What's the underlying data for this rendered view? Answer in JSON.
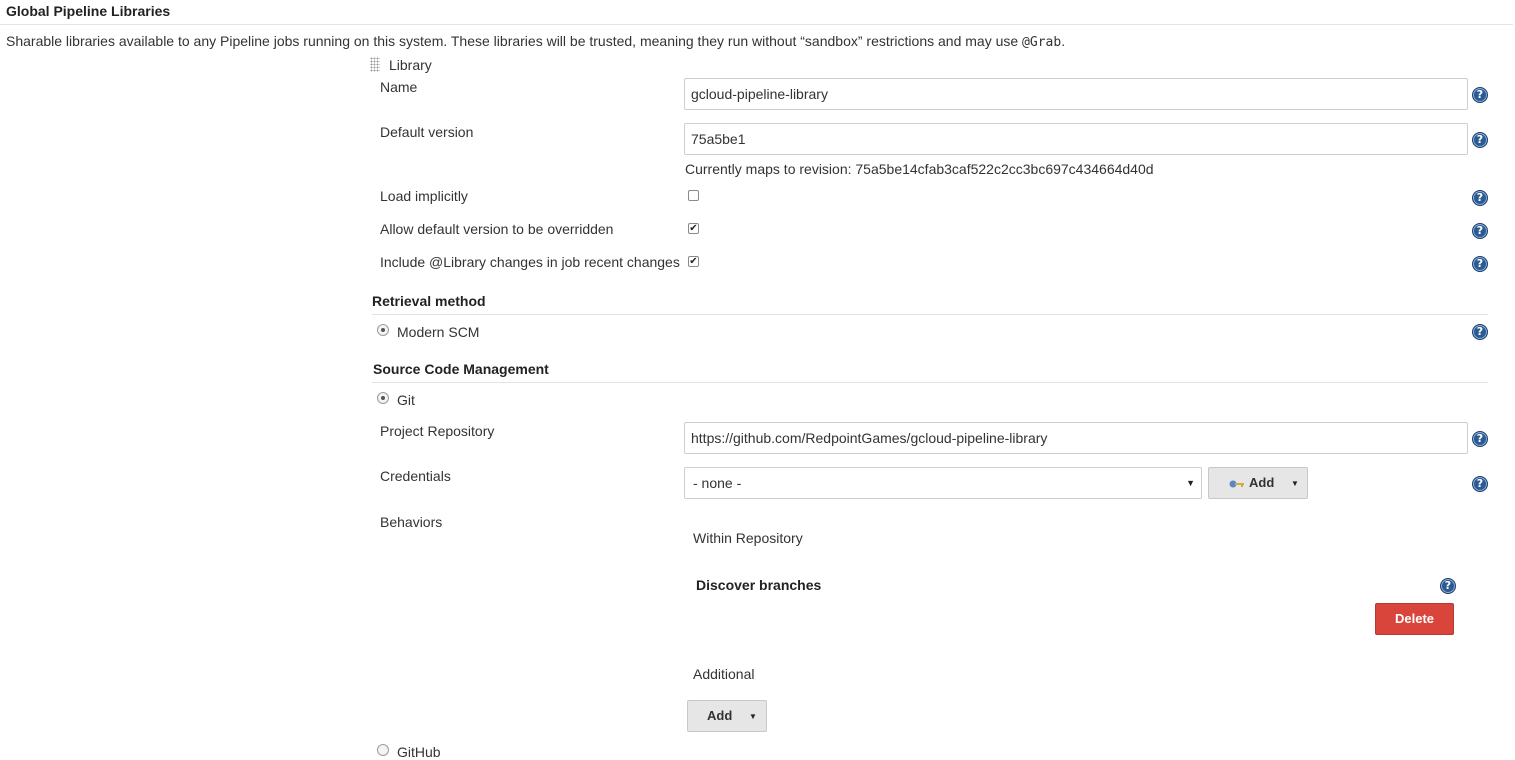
{
  "header": {
    "title": "Global Pipeline Libraries",
    "description_main": "Sharable libraries available to any Pipeline jobs running on this system. These libraries will be trusted, meaning they run without “sandbox” restrictions and may use ",
    "description_code": "@Grab",
    "description_end": "."
  },
  "library": {
    "heading": "Library",
    "name_label": "Name",
    "name_value": "gcloud-pipeline-library",
    "default_version_label": "Default version",
    "default_version_value": "75a5be1",
    "revision_note": "Currently maps to revision: 75a5be14cfab3caf522c2cc3bc697c434664d40d",
    "load_implicitly_label": "Load implicitly",
    "load_implicitly_checked": false,
    "allow_override_label": "Allow default version to be overridden",
    "allow_override_checked": true,
    "include_changes_label": "Include @Library changes in job recent changes",
    "include_changes_checked": true
  },
  "retrieval": {
    "heading": "Retrieval method",
    "option_modern_scm": "Modern SCM"
  },
  "scm": {
    "heading": "Source Code Management",
    "option_git": "Git",
    "project_repository_label": "Project Repository",
    "project_repository_value": "https://github.com/RedpointGames/gcloud-pipeline-library",
    "credentials_label": "Credentials",
    "credentials_selected": "- none -",
    "credentials_add_label": "Add",
    "behaviors_label": "Behaviors",
    "within_repository_label": "Within Repository",
    "discover_branches_label": "Discover branches",
    "delete_label": "Delete",
    "additional_label": "Additional",
    "additional_add_label": "Add",
    "option_github_partial": "GitHub"
  },
  "icons": {
    "help": "question-circle-icon",
    "key": "key-icon",
    "grip": "drag-handle-icon"
  },
  "colors": {
    "help_blue": "#2c5a93",
    "delete_red": "#d9453a",
    "button_grey": "#e6e6e6"
  }
}
